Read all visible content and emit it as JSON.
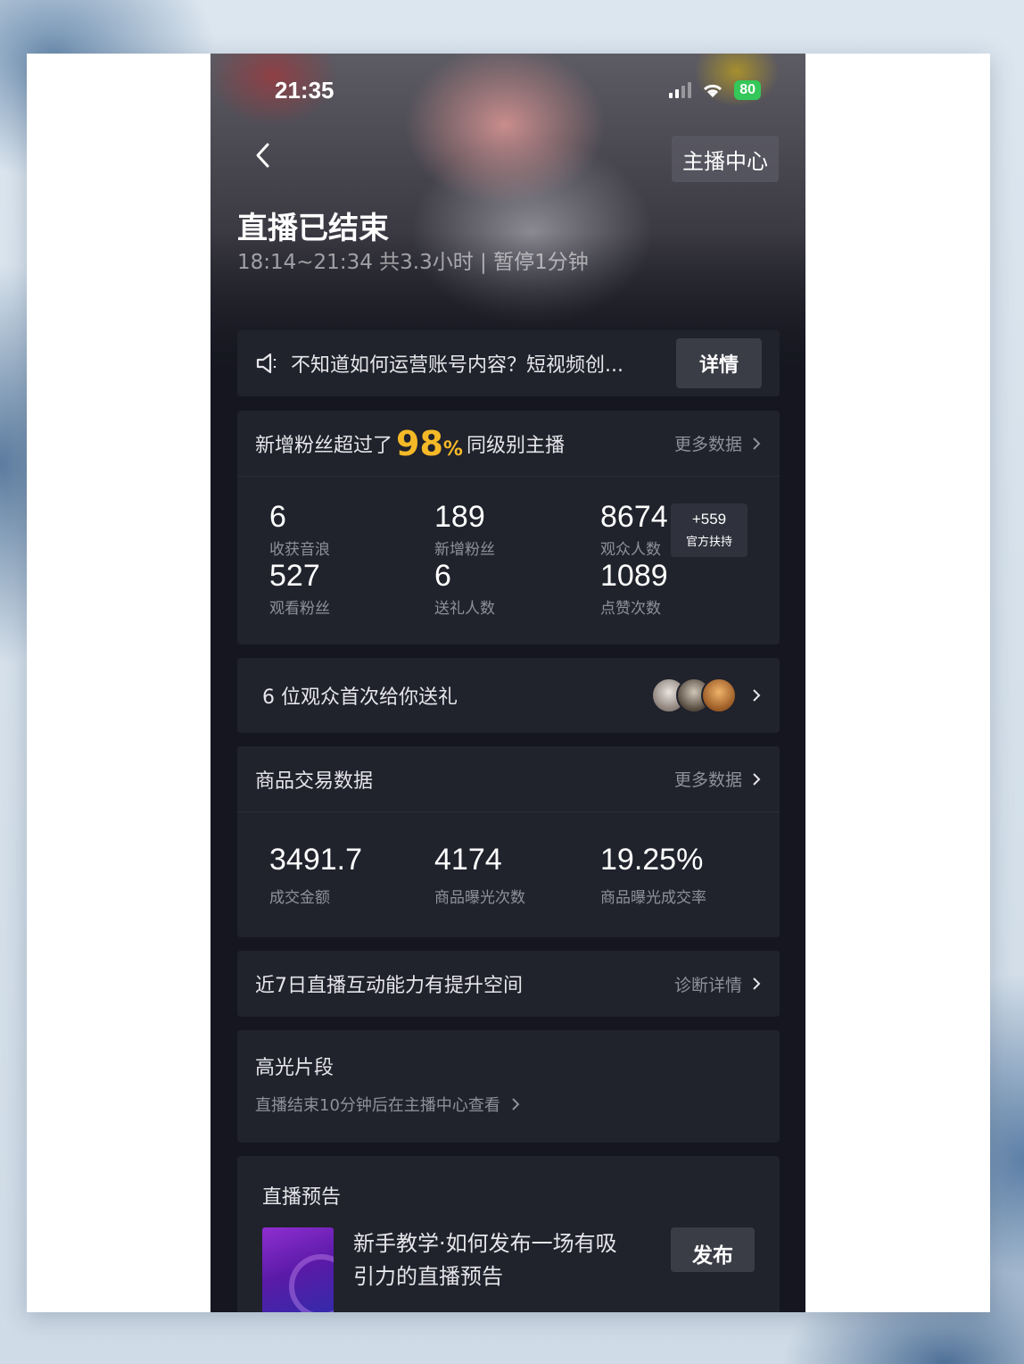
{
  "status_bar": {
    "time": "21:35",
    "battery": "80"
  },
  "header": {
    "anchor_center": "主播中心",
    "title": "直播已结束",
    "subtitle": "18:14~21:34 共3.3小时 | 暂停1分钟"
  },
  "notice": {
    "text": "不知道如何运营账号内容？短视频创...",
    "button": "详情"
  },
  "fan_stats": {
    "prefix": "新增粉丝超过了",
    "percent": "98",
    "percent_sign": "%",
    "suffix": "同级别主播",
    "more": "更多数据",
    "items": [
      {
        "value": "6",
        "label": "收获音浪"
      },
      {
        "value": "189",
        "label": "新增粉丝"
      },
      {
        "value": "8674",
        "label": "观众人数"
      },
      {
        "value": "527",
        "label": "观看粉丝"
      },
      {
        "value": "6",
        "label": "送礼人数"
      },
      {
        "value": "1089",
        "label": "点赞次数"
      }
    ],
    "boost": {
      "value": "+559",
      "label": "官方扶持"
    }
  },
  "gifts": {
    "text": "6 位观众首次给你送礼"
  },
  "trade": {
    "title": "商品交易数据",
    "more": "更多数据",
    "items": [
      {
        "value": "3491.7",
        "label": "成交金额"
      },
      {
        "value": "4174",
        "label": "商品曝光次数"
      },
      {
        "value": "19.25%",
        "label": "商品曝光成交率"
      }
    ]
  },
  "interaction": {
    "text": "近7日直播互动能力有提升空间",
    "link": "诊断详情"
  },
  "highlight": {
    "title": "高光片段",
    "subtitle": "直播结束10分钟后在主播中心查看"
  },
  "preview": {
    "title": "直播预告",
    "desc_line1": "新手教学·如何发布一场有吸",
    "desc_line2": "引力的直播预告",
    "button": "发布"
  }
}
